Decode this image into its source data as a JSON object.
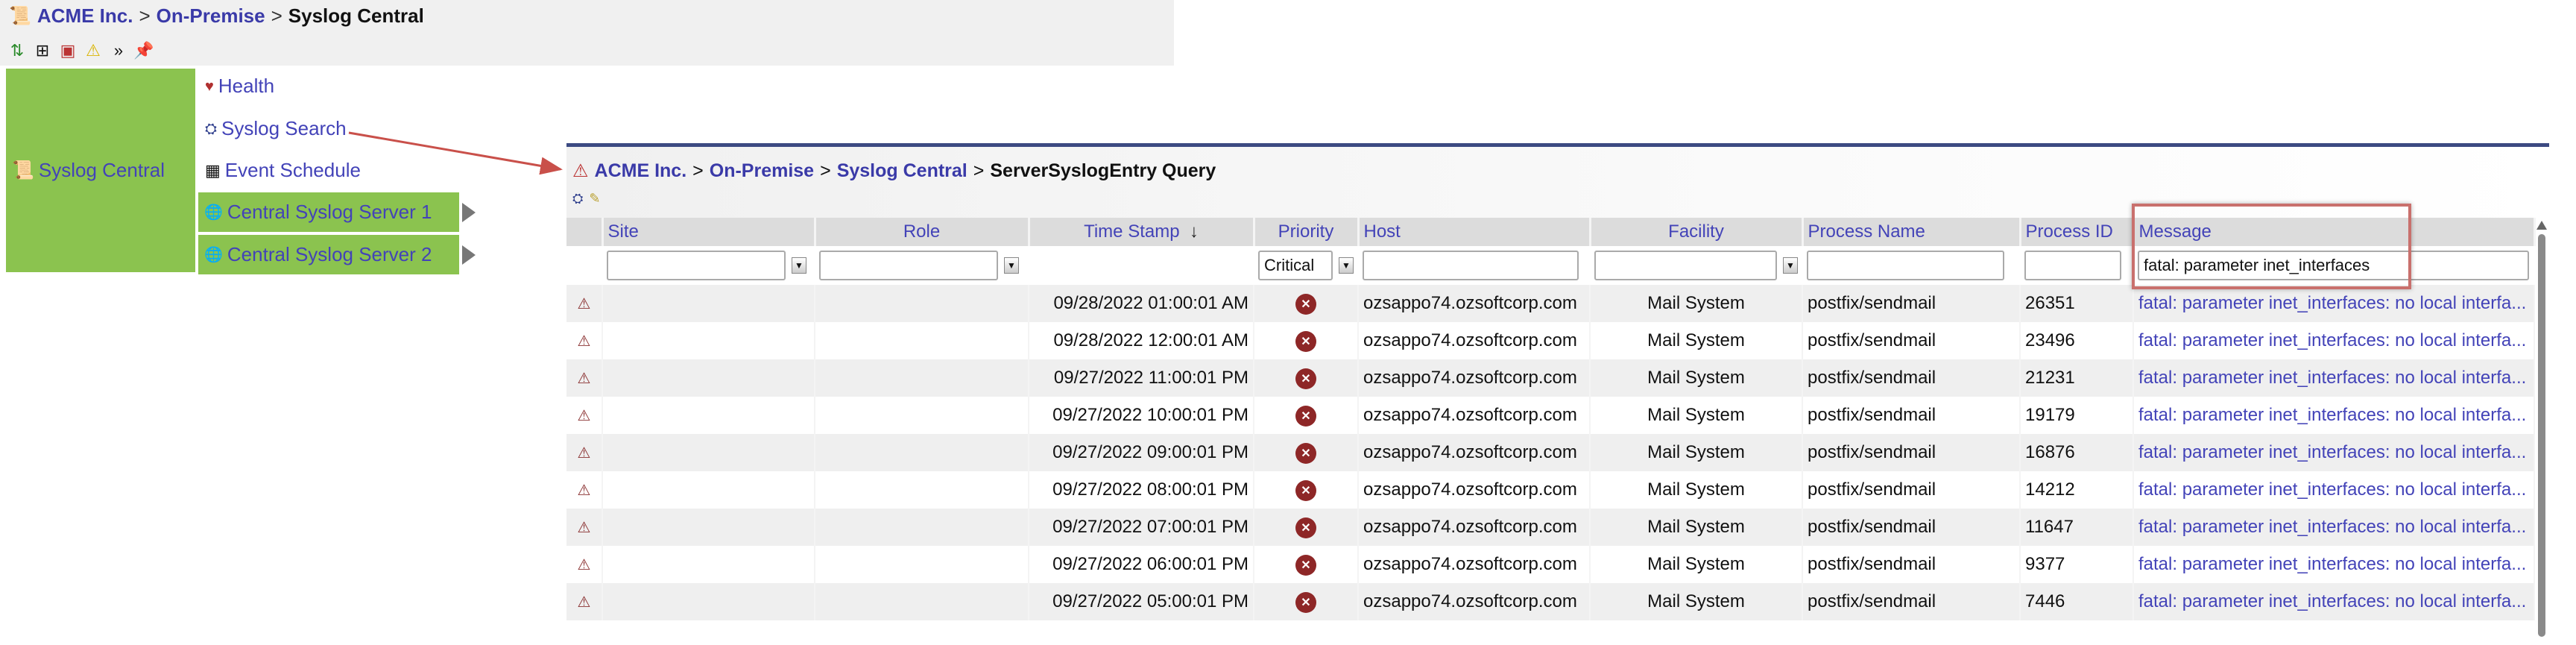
{
  "topbar": {
    "breadcrumb": [
      {
        "label": "ACME Inc."
      },
      {
        "label": "On-Premise"
      },
      {
        "label": "Syslog Central"
      }
    ],
    "separator": ">",
    "tools": [
      "refresh-icon",
      "tree-icon",
      "devices-icon",
      "warning-icon",
      "expand-icon",
      "pin-icon"
    ]
  },
  "sidebar": {
    "main": "Syslog Central",
    "menu": [
      {
        "label": "Health",
        "icon": "heart-icon"
      },
      {
        "label": "Syslog Search",
        "icon": "binoculars-icon"
      },
      {
        "label": "Event Schedule",
        "icon": "calendar-icon"
      }
    ],
    "servers": [
      {
        "label": "Central Syslog Server 1"
      },
      {
        "label": "Central Syslog Server 2"
      }
    ]
  },
  "panel": {
    "breadcrumb": [
      {
        "label": "ACME Inc."
      },
      {
        "label": "On-Premise"
      },
      {
        "label": "Syslog Central"
      },
      {
        "label": "ServerSyslogEntry Query"
      }
    ],
    "columns": [
      "Site",
      "Role",
      "Time Stamp",
      "Priority",
      "Host",
      "Facility",
      "Process Name",
      "Process ID",
      "Message"
    ],
    "sort_indicator": "↓",
    "filters": {
      "site": "",
      "role": "",
      "priority": "Critical",
      "host": "",
      "facility": "",
      "process_name": "",
      "process_id": "",
      "message": "fatal: parameter inet_interfaces"
    },
    "rows": [
      {
        "site": "",
        "role": "",
        "timestamp": "09/28/2022 01:00:01 AM",
        "host": "ozsappo74.ozsoftcorp.com",
        "facility": "Mail System",
        "process": "postfix/sendmail",
        "pid": "26351",
        "message": "fatal: parameter inet_interfaces: no local interfa..."
      },
      {
        "site": "",
        "role": "",
        "timestamp": "09/28/2022 12:00:01 AM",
        "host": "ozsappo74.ozsoftcorp.com",
        "facility": "Mail System",
        "process": "postfix/sendmail",
        "pid": "23496",
        "message": "fatal: parameter inet_interfaces: no local interfa..."
      },
      {
        "site": "",
        "role": "",
        "timestamp": "09/27/2022 11:00:01 PM",
        "host": "ozsappo74.ozsoftcorp.com",
        "facility": "Mail System",
        "process": "postfix/sendmail",
        "pid": "21231",
        "message": "fatal: parameter inet_interfaces: no local interfa..."
      },
      {
        "site": "",
        "role": "",
        "timestamp": "09/27/2022 10:00:01 PM",
        "host": "ozsappo74.ozsoftcorp.com",
        "facility": "Mail System",
        "process": "postfix/sendmail",
        "pid": "19179",
        "message": "fatal: parameter inet_interfaces: no local interfa..."
      },
      {
        "site": "",
        "role": "",
        "timestamp": "09/27/2022 09:00:01 PM",
        "host": "ozsappo74.ozsoftcorp.com",
        "facility": "Mail System",
        "process": "postfix/sendmail",
        "pid": "16876",
        "message": "fatal: parameter inet_interfaces: no local interfa..."
      },
      {
        "site": "",
        "role": "",
        "timestamp": "09/27/2022 08:00:01 PM",
        "host": "ozsappo74.ozsoftcorp.com",
        "facility": "Mail System",
        "process": "postfix/sendmail",
        "pid": "14212",
        "message": "fatal: parameter inet_interfaces: no local interfa..."
      },
      {
        "site": "",
        "role": "",
        "timestamp": "09/27/2022 07:00:01 PM",
        "host": "ozsappo74.ozsoftcorp.com",
        "facility": "Mail System",
        "process": "postfix/sendmail",
        "pid": "11647",
        "message": "fatal: parameter inet_interfaces: no local interfa..."
      },
      {
        "site": "",
        "role": "",
        "timestamp": "09/27/2022 06:00:01 PM",
        "host": "ozsappo74.ozsoftcorp.com",
        "facility": "Mail System",
        "process": "postfix/sendmail",
        "pid": "9377",
        "message": "fatal: parameter inet_interfaces: no local interfa..."
      },
      {
        "site": "",
        "role": "",
        "timestamp": "09/27/2022 05:00:01 PM",
        "host": "ozsappo74.ozsoftcorp.com",
        "facility": "Mail System",
        "process": "postfix/sendmail",
        "pid": "7446",
        "message": "fatal: parameter inet_interfaces: no local interfa..."
      }
    ]
  },
  "colors": {
    "accent_green": "#8bc34f",
    "link": "#4343b8",
    "navy_bar": "#3c4a82",
    "critical": "#8e2727",
    "annotation": "#c9706d"
  }
}
